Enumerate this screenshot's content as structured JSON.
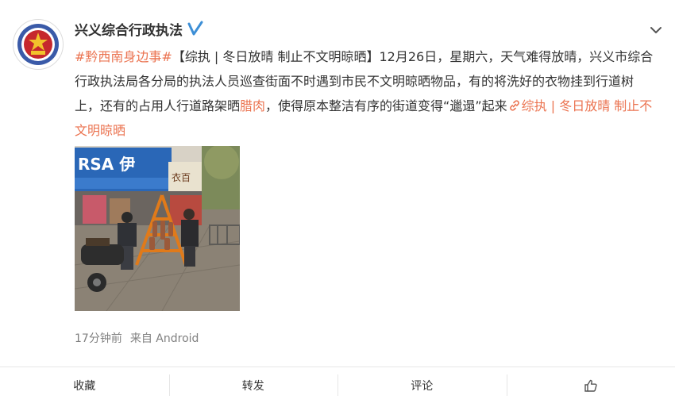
{
  "author": {
    "name": "兴义综合行政执法"
  },
  "post": {
    "topic": "#黔西南身边事#",
    "segments": [
      {
        "t": "【综执 | 冬日放晴 制止不文明晾晒】12月26日，星期六，天气难得放晴，兴义市综合行政执法局各分局的执法人员巡查街面不时遇到市民不文明晾晒物品，有的将洗好的衣物挂到行道树上，还有的占用人行道路架晒"
      },
      {
        "t": "腊肉",
        "highlight": true
      },
      {
        "t": "，使得原本整洁有序的街道变得“邋遢”起来"
      }
    ],
    "link_text": "综执 | 冬日放晴 制止不文明晾晒"
  },
  "meta": {
    "time": "17分钟前",
    "source": "来自 Android"
  },
  "actions": {
    "favorite": "收藏",
    "repost": "转发",
    "comment": "评论"
  },
  "photo": {
    "sign_main": "RSA 伊",
    "sign_shop": "衣百"
  },
  "colors": {
    "accent": "#eb7350",
    "text": "#333333",
    "meta": "#808080",
    "verified": "#3d8fd6"
  },
  "icons": [
    "verified-icon",
    "chevron-down-icon",
    "link-icon",
    "like-icon"
  ]
}
